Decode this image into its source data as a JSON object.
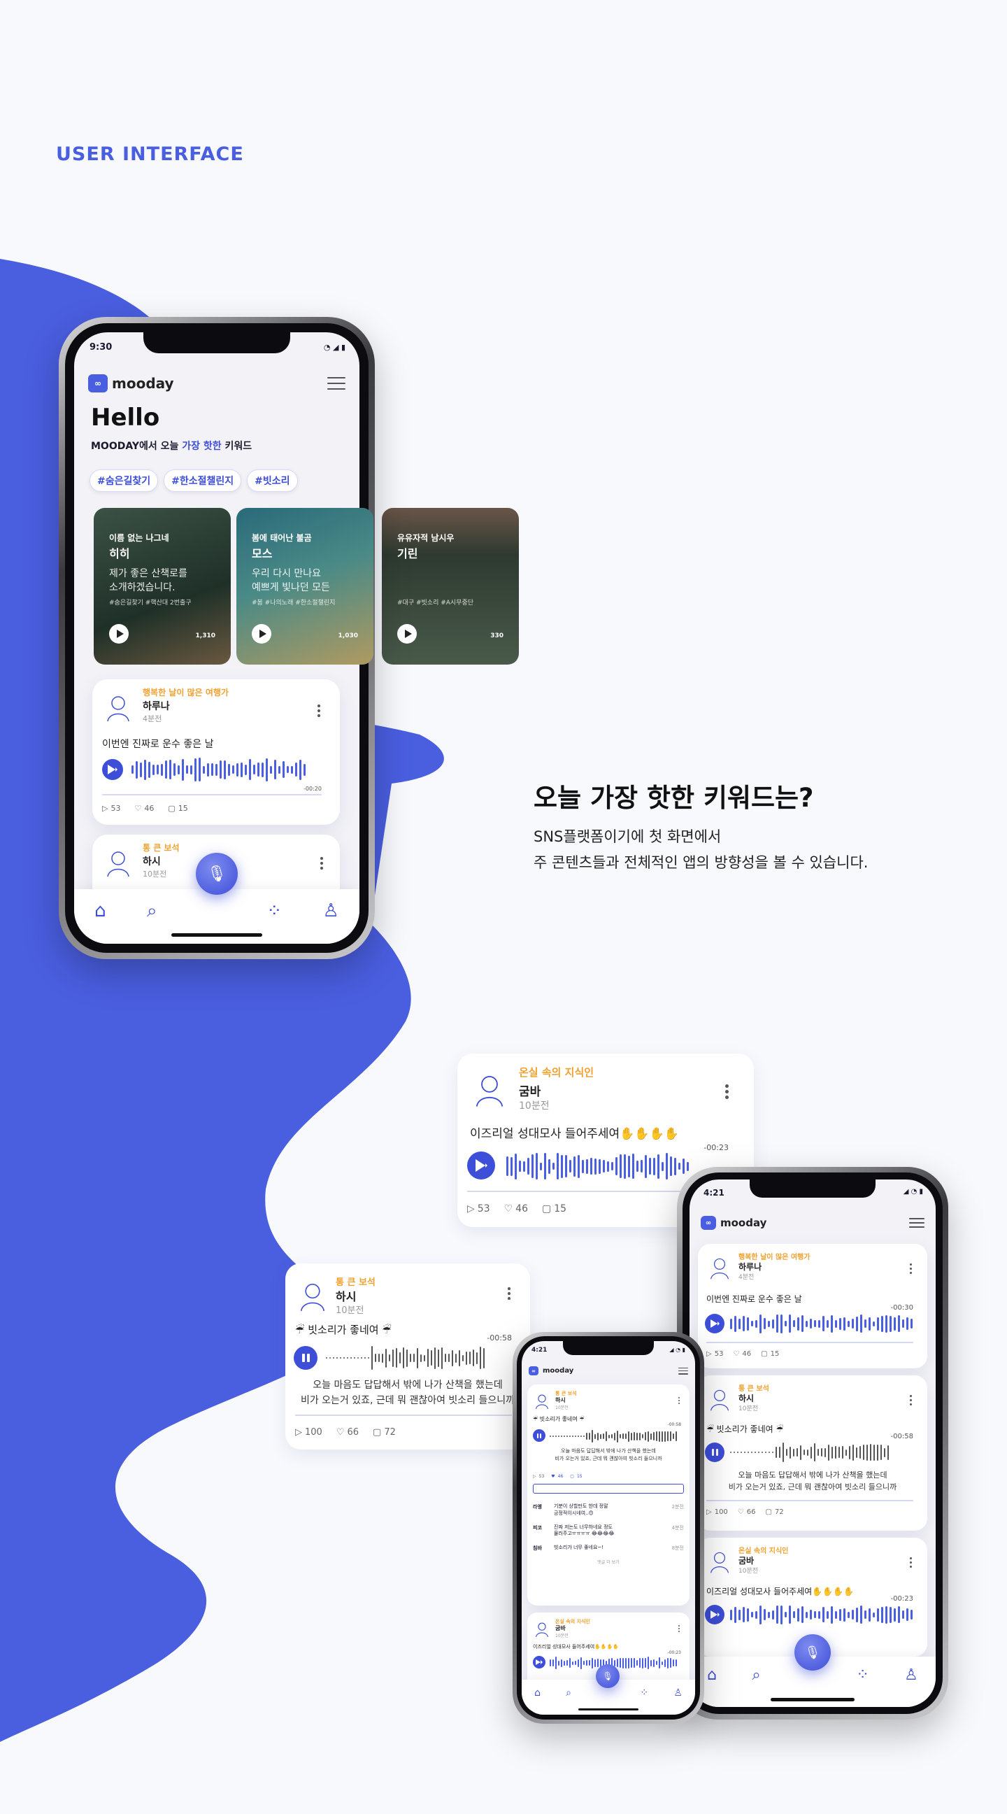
{
  "section_label": "USER INTERFACE",
  "headline": "오늘 가장 핫한 키워드는?",
  "subline": [
    "SNS플랫폼이기에 첫 화면에서",
    "주 콘텐츠들과 전체적인 앱의 방향성을 볼 수 있습니다."
  ],
  "colors": {
    "accent": "#4a5ee0",
    "category": "#f0a12f",
    "background": "#f8f9fd"
  },
  "app": {
    "logo_text": "mooday"
  },
  "main_phone": {
    "status_time": "9:30",
    "hello": "Hello",
    "subtitle_pre": "MOODAY에서 오늘 ",
    "subtitle_em": "가장 핫한",
    "subtitle_post": " 키워드",
    "chips": [
      "#숨은길찾기",
      "#한소절챌린지",
      "#빗소리"
    ],
    "cards": [
      {
        "sub": "이름 없는 나그네",
        "name": "히히",
        "body": "제가 좋은 산책로를\n소개하겠습니다.",
        "tags": "#숨은길찾기 #핵산대 2번출구",
        "count": "1,310"
      },
      {
        "sub": "봄에 태어난 불곰",
        "name": "모스",
        "body": "우리 다시 만나요\n예쁘게 빛나던 모든",
        "tags": "#봄 #나의노래 #한소절챌린지",
        "count": "1,030"
      },
      {
        "sub": "유유자적 남시우",
        "name": "기린",
        "body": "",
        "tags": "#대구 #빗소리 #A시무중단",
        "count": "330"
      }
    ],
    "post1": {
      "category": "행복한 날이 많은 여행가",
      "user": "하루나",
      "time": "4분전",
      "title": "이번엔 진짜로 운수 좋은 날",
      "duration": "-00:20",
      "plays": "53",
      "likes": "46",
      "comments": "15"
    },
    "post2": {
      "category": "통 큰 보석",
      "user": "하시",
      "time": "10분전"
    }
  },
  "float_card_top": {
    "category": "온실 속의 지식인",
    "user": "굼바",
    "time": "10분전",
    "title": "이즈리얼 성대모사 들어주세여✋✋✋✋",
    "duration": "-00:23",
    "plays": "53",
    "likes": "46",
    "comments": "15"
  },
  "float_card_left": {
    "category": "통 큰 보석",
    "user": "하시",
    "time": "10분전",
    "title": "☔ 빗소리가 좋네여 ☔",
    "duration": "-00:58",
    "desc": "오늘 마음도 답답해서 밖에 나가 산책을 했는데\n비가 오는거 있죠, 근데 뭐 괜찮아여 빗소리 들으니까",
    "plays": "100",
    "likes": "66",
    "comments": "72"
  },
  "small_phone": {
    "status_time": "4:21",
    "post": {
      "category": "통 큰 보석",
      "user": "하시",
      "time": "10분전",
      "title": "☔ 빗소리가 좋네여 ☔",
      "duration": "-00:58",
      "desc": "오늘 마음도 답답해서 밖에 나가 산책을 했는데\n비가 오는거 있죠, 근데 뭐 괜찮아여 빗소리 들으니까",
      "plays": "53",
      "likes": "46",
      "comments": "15"
    },
    "comments": [
      {
        "user": "라엥",
        "text": "기분이 상할만도 한데 정말\n긍정적이시네여..😊",
        "time": "2분전"
      },
      {
        "user": "피코",
        "text": "진짜 저는도 너무하네요 정도\n물러주고ㅠㅠㅠㅠ 😂😂😂😂",
        "time": "4분전"
      },
      {
        "user": "침바",
        "text": "빗소리가 너무 좋네요~!",
        "time": "8분전"
      }
    ],
    "more_comments": "댓글 더 보기",
    "post2": {
      "category": "온실 속의 지식인",
      "user": "굼바",
      "time": "10분전",
      "title": "이즈리얼 성대모사 들어주세여✋✋✋✋",
      "duration": "-00:23"
    }
  },
  "right_phone": {
    "status_time": "4:21",
    "post1": {
      "category": "행복한 날이 많은 여행가",
      "user": "하루나",
      "time": "4분전",
      "title": "이번엔 진짜로 운수 좋은 날",
      "duration": "-00:30",
      "plays": "53",
      "likes": "46",
      "comments": "15"
    },
    "post2": {
      "category": "통 큰 보석",
      "user": "하시",
      "time": "10분전",
      "title": "☔ 빗소리가 좋네여 ☔",
      "duration": "-00:58",
      "desc": "오늘 마음도 답답해서 밖에 나가 산책을 했는데\n비가 오는거 있죠, 근데 뭐 괜찮아여 빗소리 들으니까",
      "plays": "100",
      "likes": "66",
      "comments": "72"
    },
    "post3": {
      "category": "온실 속의 지식인",
      "user": "굼바",
      "time": "10분전",
      "title": "이즈리얼 성대모사 들어주세여✋✋✋✋",
      "duration": "-00:23"
    }
  }
}
